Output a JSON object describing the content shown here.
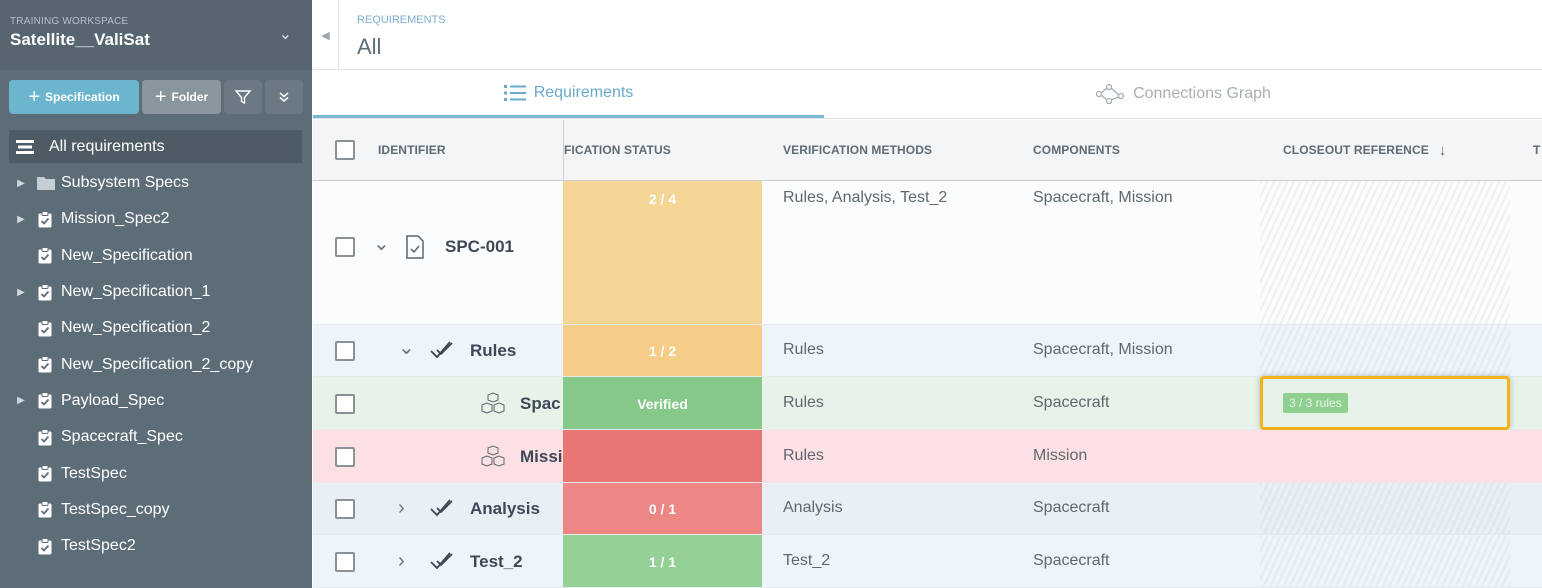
{
  "sidebar": {
    "workspace_label": "TRAINING WORKSPACE",
    "workspace_name": "Satellite__ValiSat",
    "add_spec_label": "Specification",
    "add_folder_label": "Folder",
    "all_requirements": "All requirements",
    "items": [
      {
        "label": "Subsystem Specs",
        "icon": "folder-icon",
        "expandable": true
      },
      {
        "label": "Mission_Spec2",
        "icon": "clipboard-check-icon",
        "expandable": true
      },
      {
        "label": "New_Specification",
        "icon": "clipboard-check-icon",
        "expandable": false
      },
      {
        "label": "New_Specification_1",
        "icon": "clipboard-check-icon",
        "expandable": true
      },
      {
        "label": "New_Specification_2",
        "icon": "clipboard-check-icon",
        "expandable": false
      },
      {
        "label": "New_Specification_2_copy",
        "icon": "clipboard-check-icon",
        "expandable": false
      },
      {
        "label": "Payload_Spec",
        "icon": "clipboard-check-icon",
        "expandable": true
      },
      {
        "label": "Spacecraft_Spec",
        "icon": "clipboard-check-icon",
        "expandable": false
      },
      {
        "label": "TestSpec",
        "icon": "clipboard-check-icon",
        "expandable": false
      },
      {
        "label": "TestSpec_copy",
        "icon": "clipboard-check-icon",
        "expandable": false
      },
      {
        "label": "TestSpec2",
        "icon": "clipboard-check-icon",
        "expandable": false
      }
    ]
  },
  "header": {
    "breadcrumb": "REQUIREMENTS",
    "title": "All"
  },
  "tabs": [
    {
      "label": "Requirements",
      "active": true
    },
    {
      "label": "Connections Graph",
      "active": false
    }
  ],
  "table": {
    "columns": [
      "IDENTIFIER",
      "FICATION STATUS",
      "VERIFICATION METHODS",
      "COMPONENTS",
      "CLOSEOUT REFERENCE",
      "T"
    ],
    "rows": [
      {
        "identifier": "SPC-001",
        "icon": "document-check-icon",
        "expander": "down",
        "status": "2 / 4",
        "status_color": "#f5d596",
        "methods": "Rules, Analysis, Test_2",
        "components": "Spacecraft, Mission",
        "closeout": "",
        "bg": "#fbfcfd"
      },
      {
        "identifier": "Rules",
        "icon": "double-check-icon",
        "expander": "down",
        "status": "1 / 2",
        "status_color": "#f5cd88",
        "methods": "Rules",
        "components": "Spacecraft, Mission",
        "closeout": "",
        "bg": "#edf4fa"
      },
      {
        "identifier": "Spac",
        "icon": "cubes-icon",
        "expander": "",
        "status": "Verified",
        "status_color": "#86c78a",
        "methods": "Rules",
        "components": "Spacecraft",
        "closeout": "3 / 3 rules",
        "bg": "#e7f3e8"
      },
      {
        "identifier": "Missi",
        "icon": "cubes-icon",
        "expander": "",
        "status": "",
        "status_color": "#e77674",
        "methods": "Rules",
        "components": "Mission",
        "closeout": "",
        "bg": "#fde0e3"
      },
      {
        "identifier": "Analysis",
        "icon": "double-check-icon",
        "expander": "right",
        "status": "0 / 1",
        "status_color": "#ec8786",
        "methods": "Analysis",
        "components": "Spacecraft",
        "closeout": "",
        "bg": "#e8f0f5"
      },
      {
        "identifier": "Test_2",
        "icon": "double-check-icon",
        "expander": "right",
        "status": "1 / 1",
        "status_color": "#95d096",
        "methods": "Test_2",
        "components": "Spacecraft",
        "closeout": "",
        "bg": "#edf4fa"
      }
    ]
  }
}
